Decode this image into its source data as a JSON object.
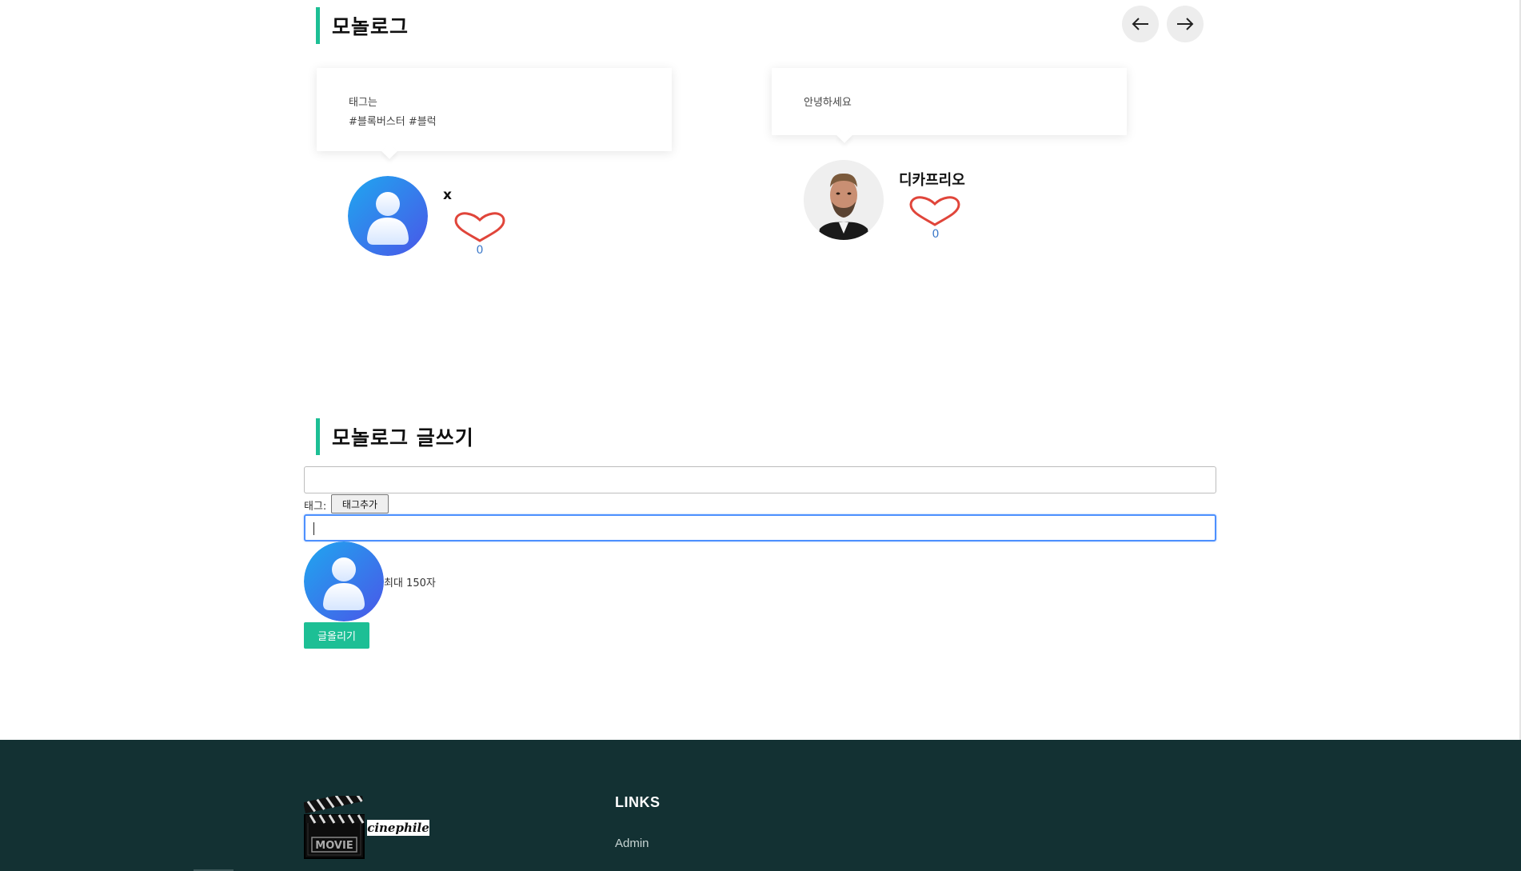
{
  "monolog": {
    "section_title": "모놀로그",
    "nav": {
      "prev_icon": "arrow-left-icon",
      "next_icon": "arrow-right-icon"
    },
    "posts": [
      {
        "lines": [
          "태그는",
          "#블록버스터 #블럭"
        ],
        "author": "x",
        "avatar_icon": "default-user-avatar-icon",
        "likes": "0",
        "heart_color": "#e0453a"
      },
      {
        "lines": [
          "안녕하세요"
        ],
        "author": "디카프리오",
        "avatar_icon": "actor-photo-avatar",
        "likes": "0",
        "heart_color": "#e0453a"
      }
    ]
  },
  "write": {
    "section_title": "모놀로그 글쓰기",
    "tag_label": "태그:",
    "tag_button": "태그추가",
    "limit": "최대 150자",
    "submit": "글올리기"
  },
  "footer": {
    "logo_text": "cinephile",
    "logo_board_text": "MOVIE",
    "links_heading": "LINKS",
    "links": [
      "Admin"
    ]
  },
  "colors": {
    "accent": "#1dbf95",
    "footer_bg": "#133133",
    "like_count": "#3a78c9",
    "focus": "#4d90fe"
  }
}
